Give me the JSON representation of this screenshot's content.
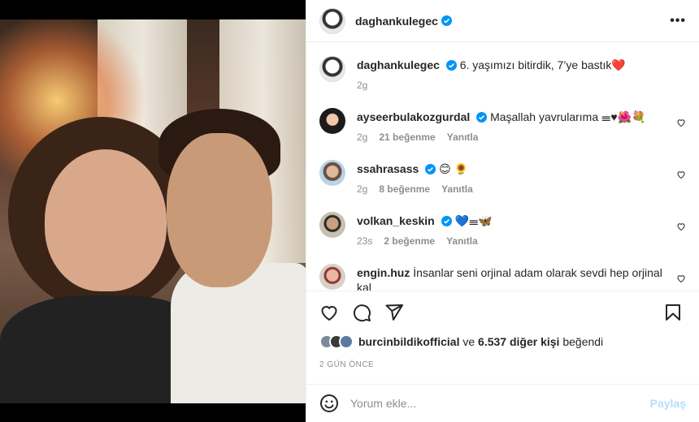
{
  "post": {
    "owner": "daghankulegec",
    "caption": "6. yaşımızı bitirdik, 7’ye bastık❤️",
    "caption_time": "2g",
    "liked_by": "burcinbildikofficial",
    "likes_and": "ve",
    "likes_rest": "6.537 diğer kişi",
    "likes_suffix": "beğendi",
    "posted_ago": "2 GÜN ÖNCE"
  },
  "comments": [
    {
      "user": "ayseerbulakozgurdal",
      "text": "Maşallah yavrularıma 𝍢♥🌺💐",
      "time": "2g",
      "likes": "21 beğenme",
      "reply": "Yanıtla",
      "verified": true
    },
    {
      "user": "ssahrasass",
      "text": "😊 🌻",
      "time": "2g",
      "likes": "8 beğenme",
      "reply": "Yanıtla",
      "verified": true
    },
    {
      "user": "volkan_keskin",
      "text": "💙𝍢🦋",
      "time": "23s",
      "likes": "2 beğenme",
      "reply": "Yanıtla",
      "verified": true
    },
    {
      "user": "engin.huz",
      "text": "İnsanlar seni orjinal adam olarak sevdi hep orjinal kal",
      "verified": false
    }
  ],
  "composer": {
    "placeholder": "Yorum ekle...",
    "post_label": "Paylaş"
  },
  "colors": {
    "verified": "#0095f6",
    "post_disabled": "#b2dffc",
    "meta": "#8e8e8e"
  }
}
